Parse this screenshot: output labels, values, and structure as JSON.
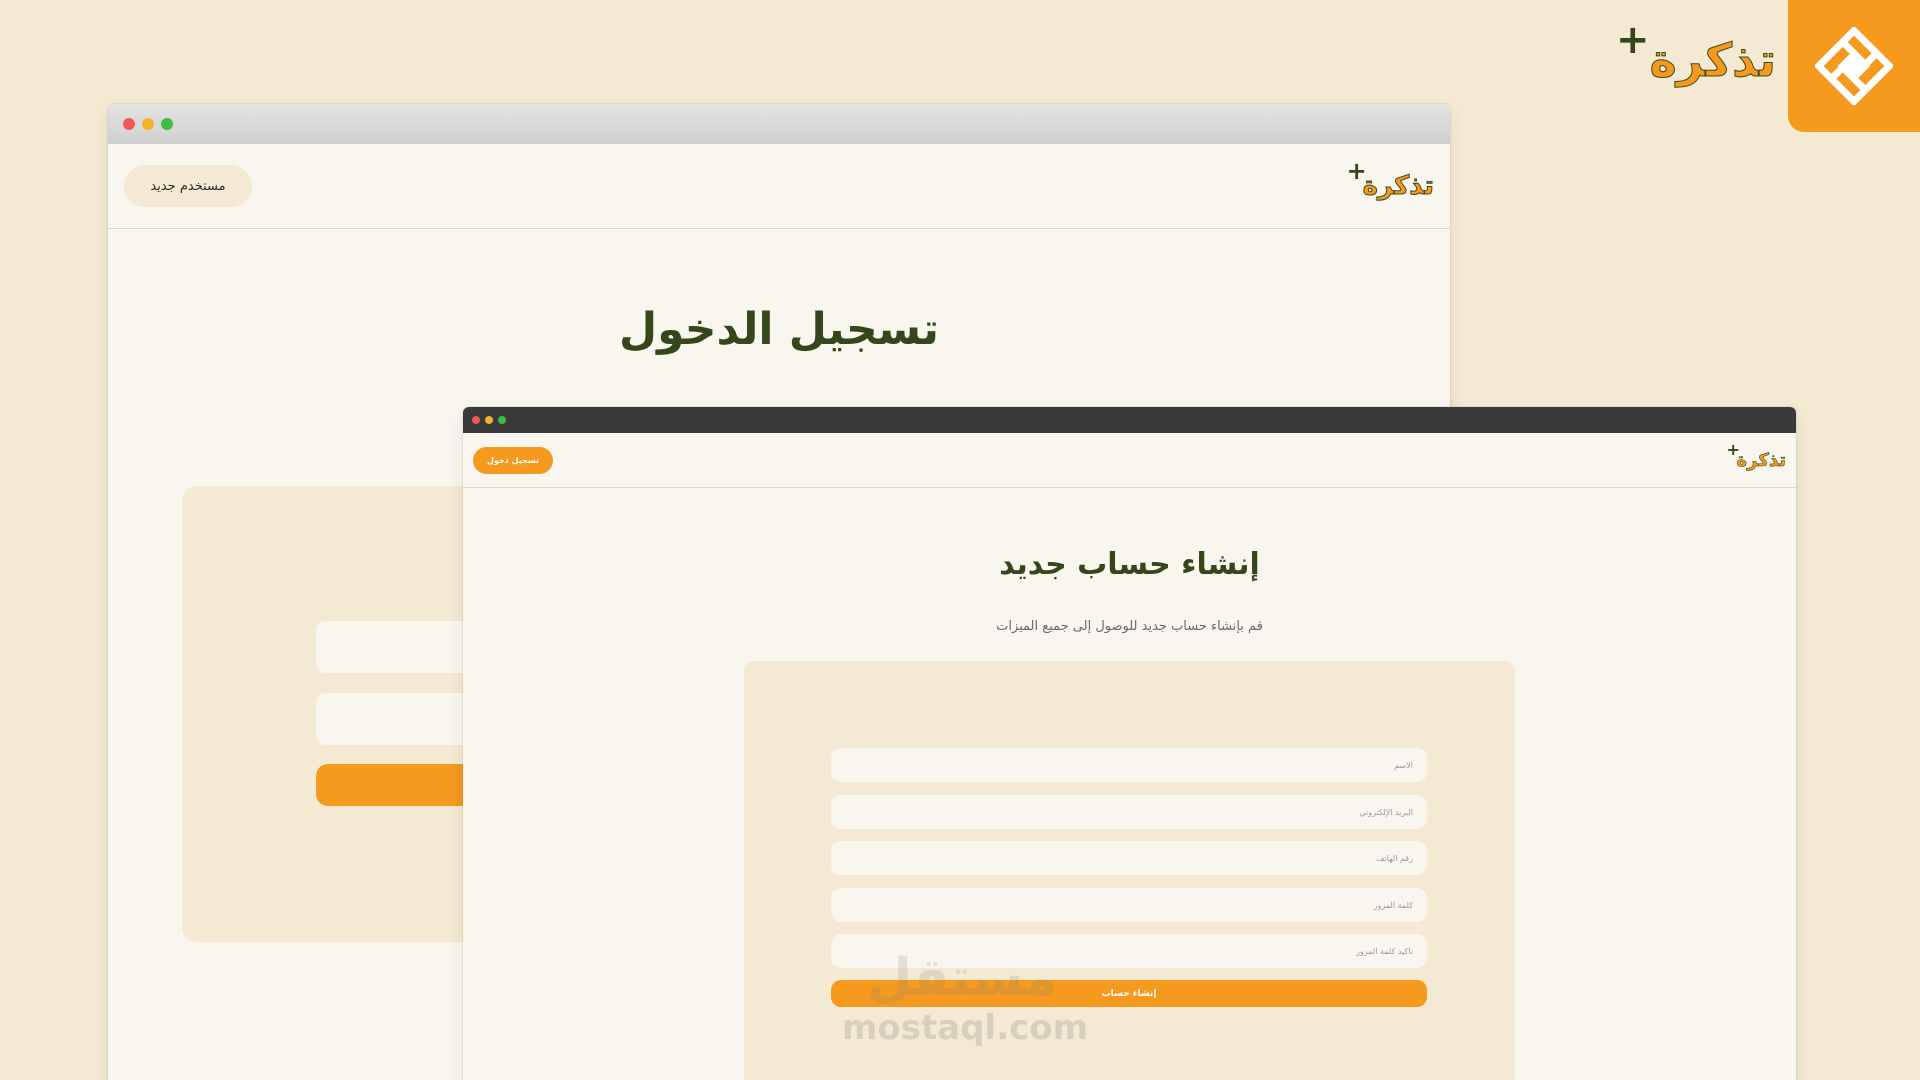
{
  "brand": {
    "name": "تذكرة",
    "plus_symbol": "+",
    "badge_icon": "geometric-knot-icon",
    "accent_color": "#f59a1f",
    "dark_green": "#34461a",
    "background": "#f4ead3"
  },
  "login_window": {
    "header": {
      "new_user_button": "مستخدم جديد",
      "logo_text": "تذكرة"
    },
    "title": "تسجيل الدخول"
  },
  "register_window": {
    "header": {
      "login_button": "تسجيل دخول",
      "logo_text": "تذكرة"
    },
    "title": "إنشاء حساب جديد",
    "subtitle": "قم بإنشاء حساب جديد للوصول إلى جميع الميزات",
    "fields": [
      {
        "placeholder": "الاسم"
      },
      {
        "placeholder": "البريد الإلكتروني"
      },
      {
        "placeholder": "رقم الهاتف"
      },
      {
        "placeholder": "كلمة المرور"
      },
      {
        "placeholder": "تأكيد كلمة المرور"
      }
    ],
    "submit_button": "إنشاء حساب"
  },
  "watermark": {
    "arabic": "مستقل",
    "latin": "mostaql.com"
  }
}
